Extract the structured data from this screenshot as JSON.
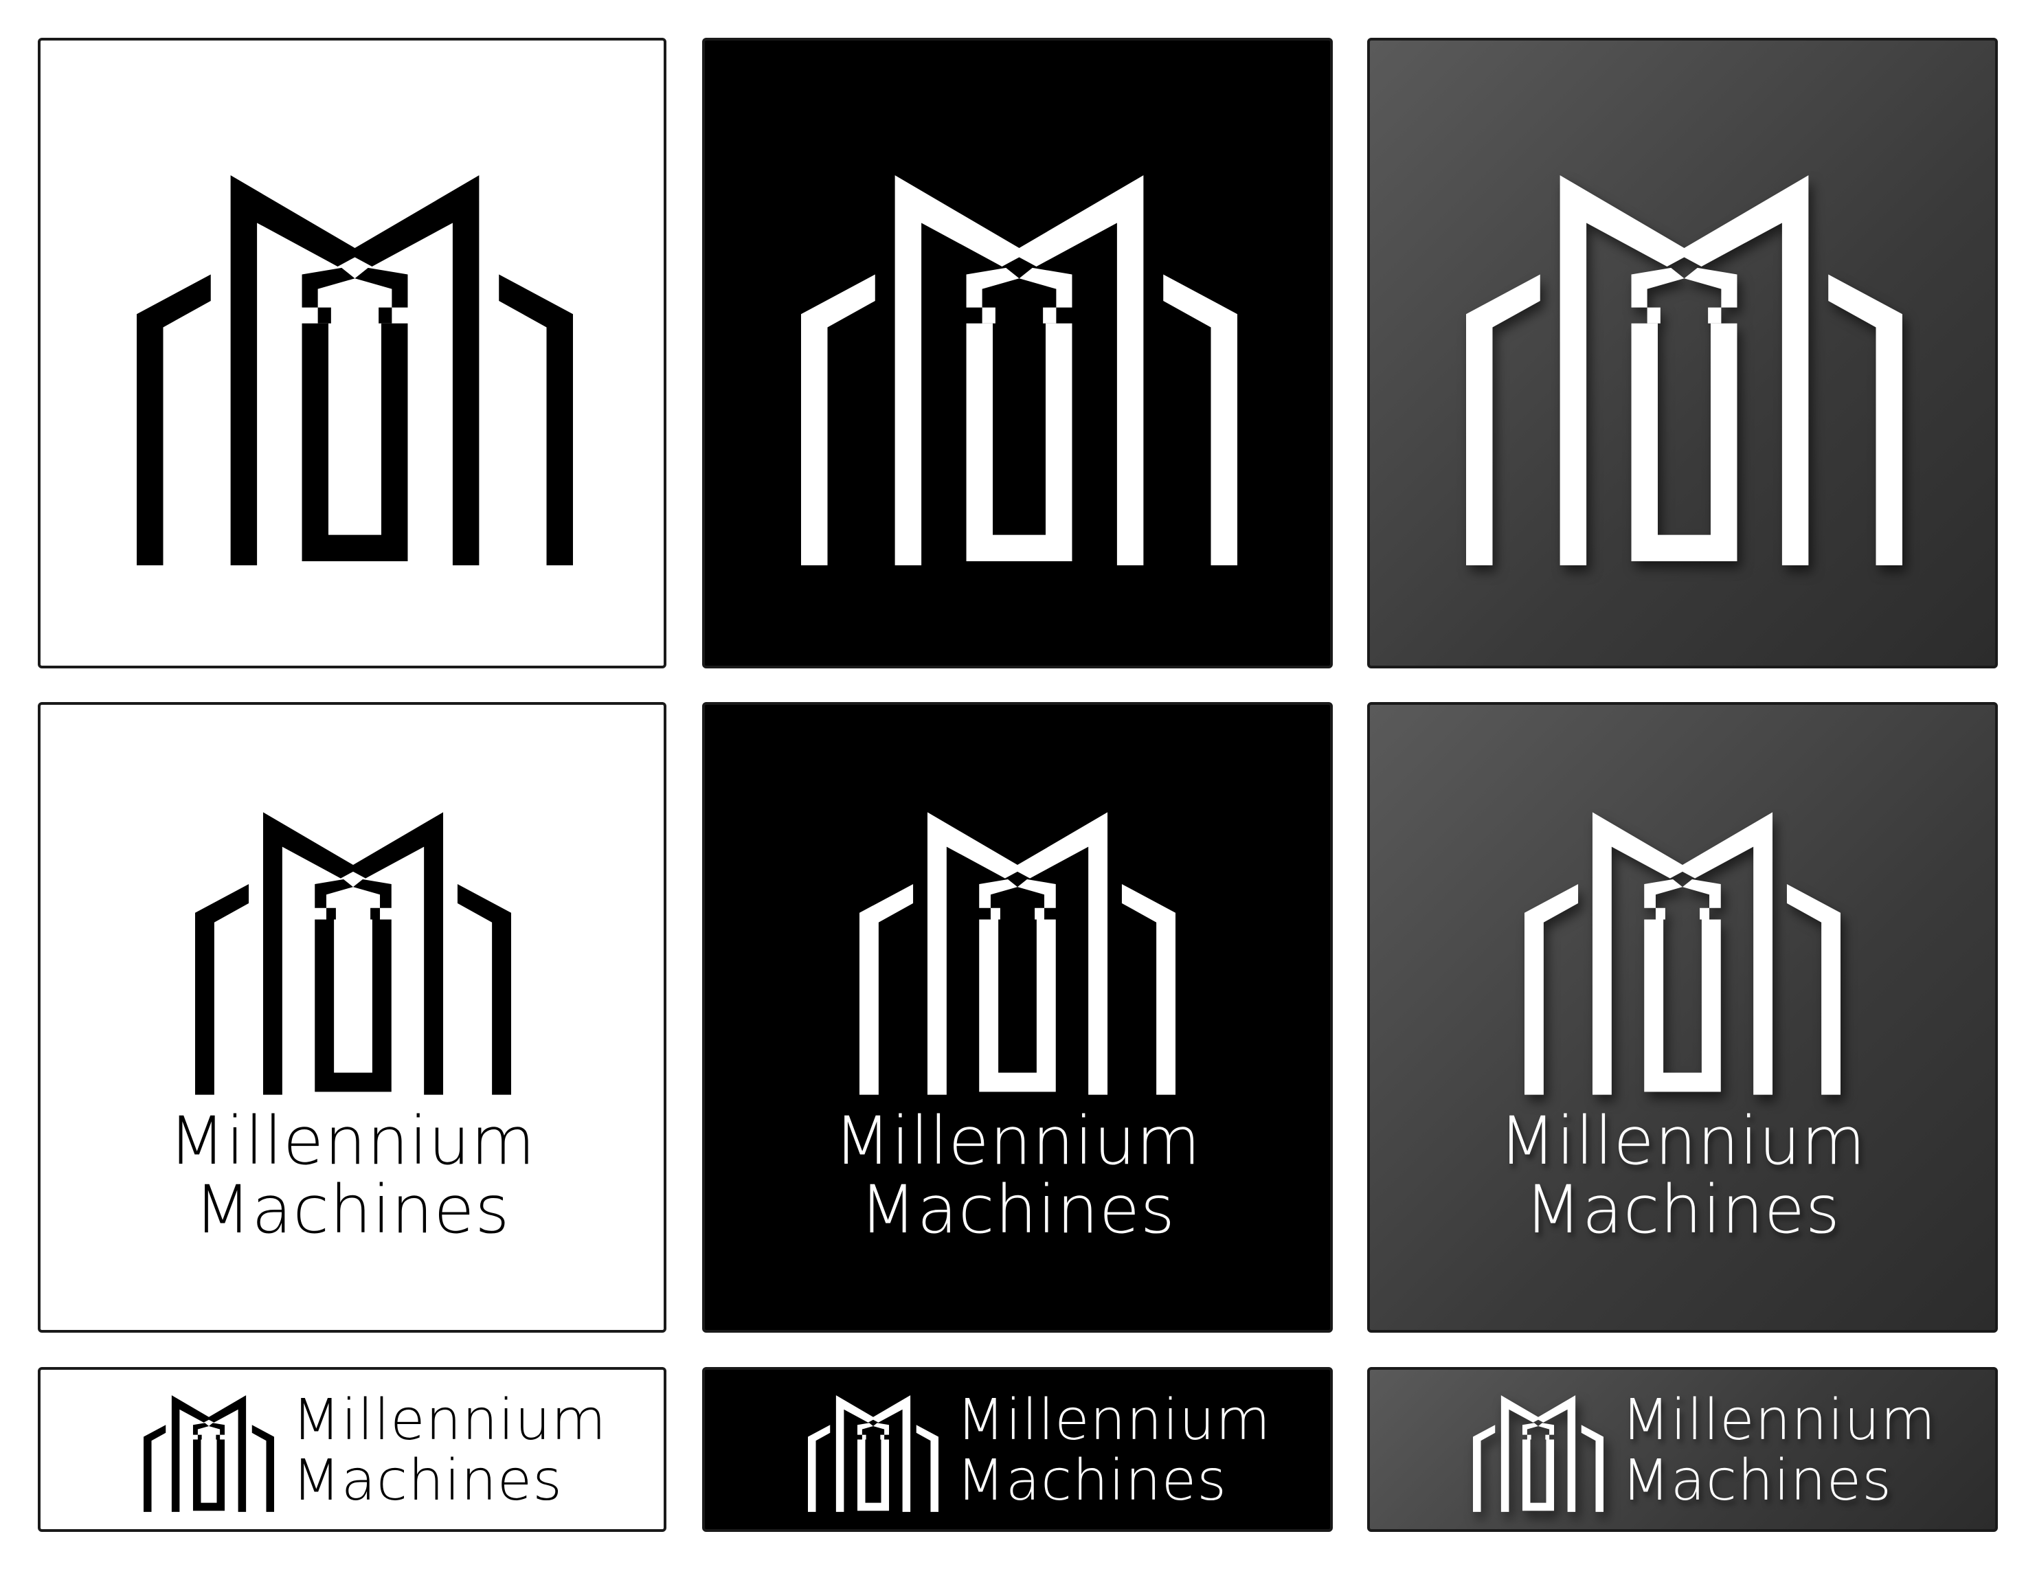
{
  "brand": {
    "name_line1": "Millennium",
    "name_line2": "Machines"
  },
  "logo_icon": "mm-building-monogram-icon",
  "themes": {
    "white": {
      "background": "#ffffff",
      "ink": "#000000"
    },
    "black": {
      "background": "#000000",
      "ink": "#ffffff"
    },
    "gray": {
      "background": "#4a4a4a",
      "ink": "#ffffff"
    }
  },
  "variants": [
    {
      "row": "icon-only",
      "themes": [
        "white",
        "black",
        "gray"
      ]
    },
    {
      "row": "stacked-wordmark",
      "themes": [
        "white",
        "black",
        "gray"
      ]
    },
    {
      "row": "horizontal-wordmark",
      "themes": [
        "white",
        "black",
        "gray"
      ]
    }
  ]
}
